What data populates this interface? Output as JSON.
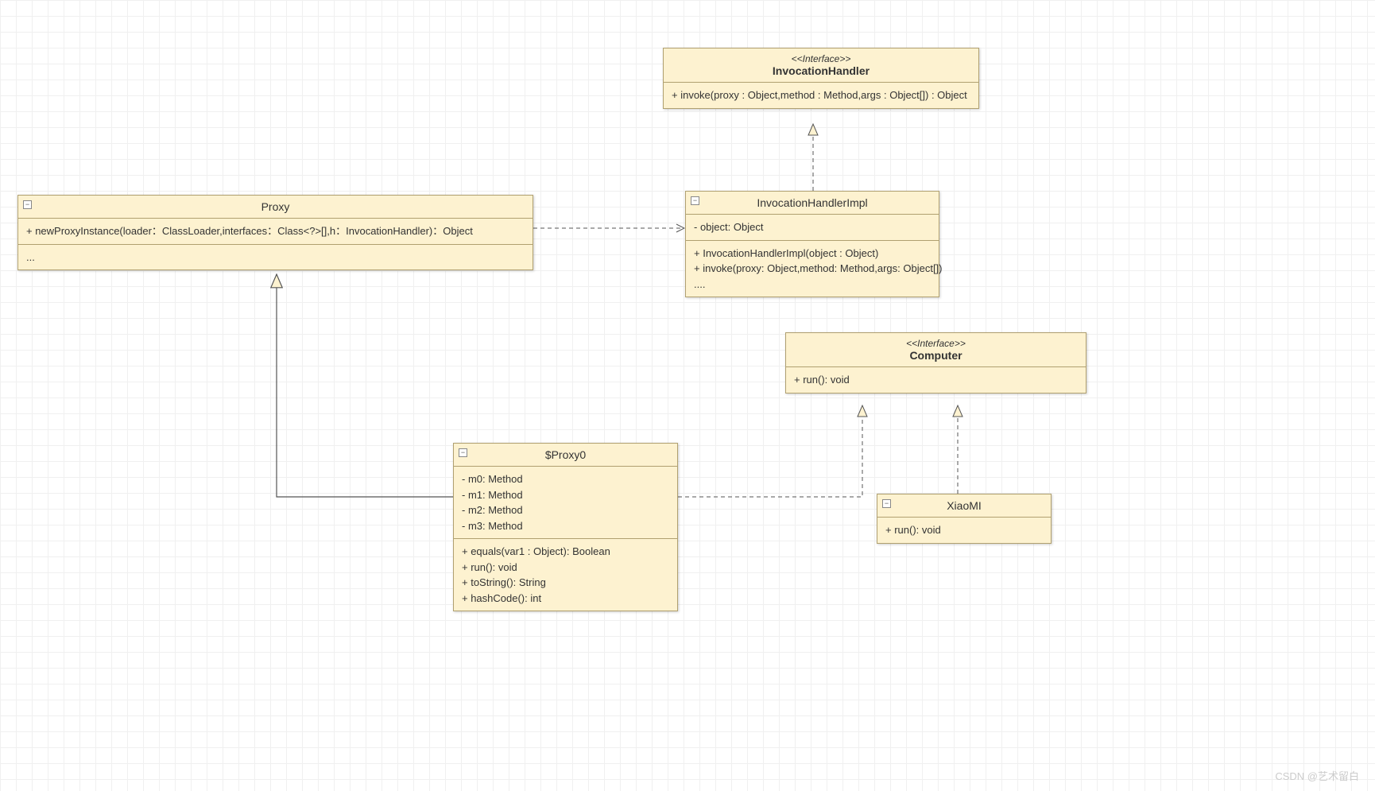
{
  "classes": {
    "invocationHandler": {
      "stereotype": "<<Interface>>",
      "name": "InvocationHandler",
      "methods": [
        "+ invoke(proxy : Object,method : Method,args : Object[]) : Object"
      ]
    },
    "proxy": {
      "name": "Proxy",
      "methods": [
        "+ newProxyInstance(loader：ClassLoader,interfaces：Class<?>[],h：InvocationHandler)：Object"
      ],
      "extra": "..."
    },
    "invocationHandlerImpl": {
      "name": "InvocationHandlerImpl",
      "attrs": [
        "- object: Object"
      ],
      "methods": [
        "+ InvocationHandlerImpl(object : Object)",
        "+ invoke(proxy: Object,method: Method,args: Object[])",
        "...."
      ]
    },
    "computer": {
      "stereotype": "<<Interface>>",
      "name": "Computer",
      "methods": [
        "+ run(): void"
      ]
    },
    "proxy0": {
      "name": "$Proxy0",
      "attrs": [
        "- m0: Method",
        "- m1: Method",
        "- m2: Method",
        "- m3: Method"
      ],
      "methods": [
        "+ equals(var1 : Object): Boolean",
        "+ run(): void",
        "+ toString(): String",
        "+ hashCode(): int"
      ]
    },
    "xiaomi": {
      "name": "XiaoMI",
      "methods": [
        "+ run(): void"
      ]
    }
  },
  "watermark": "CSDN @艺术留白"
}
